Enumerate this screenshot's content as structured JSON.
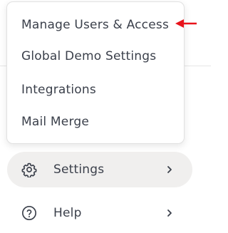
{
  "submenu": {
    "items": [
      {
        "label": "Manage Users & Access"
      },
      {
        "label": "Global Demo Settings"
      },
      {
        "label": "Integrations"
      },
      {
        "label": "Mail Merge"
      }
    ]
  },
  "menu": {
    "settings": {
      "label": "Settings",
      "icon": "gear-icon",
      "chevron": "chevron-right-icon"
    },
    "help": {
      "label": "Help",
      "icon": "question-circle-icon",
      "chevron": "chevron-right-icon"
    }
  },
  "colors": {
    "text": "#3b404b",
    "active_row_bg": "#f0efee",
    "annotation": "#e8131b"
  }
}
